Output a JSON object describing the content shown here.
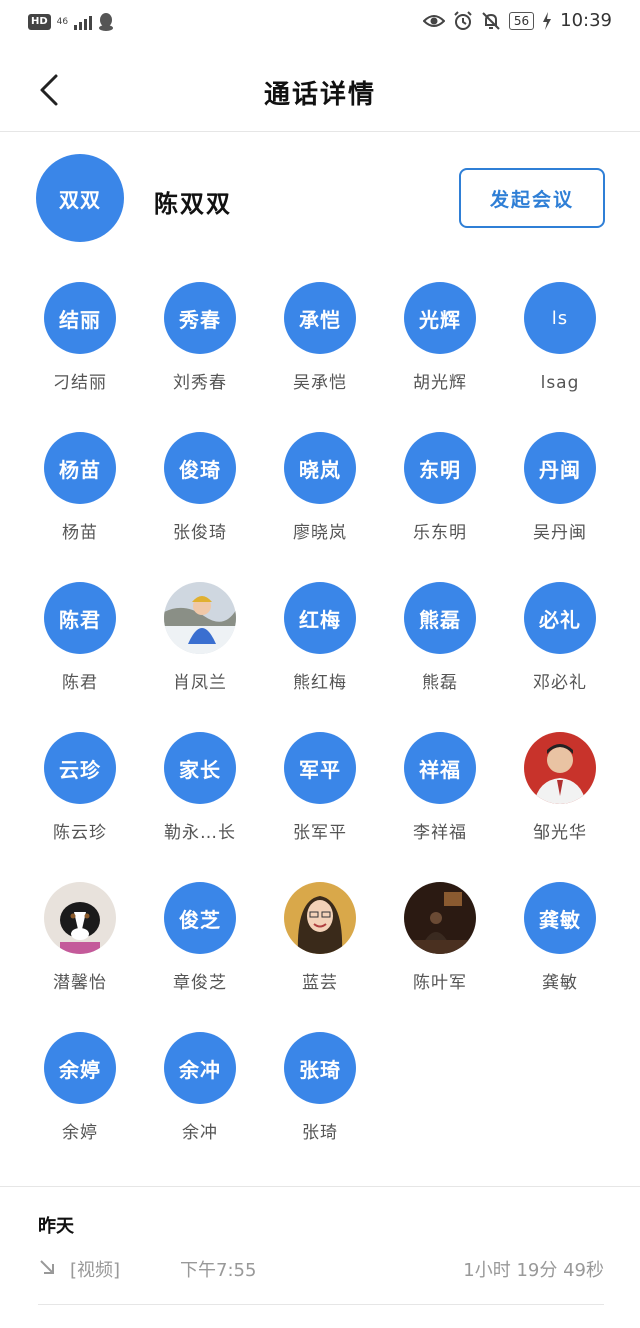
{
  "status_bar": {
    "hd": "HD",
    "network": "46",
    "battery": "56",
    "time": "10:39"
  },
  "header": {
    "title": "通话详情"
  },
  "owner": {
    "avatar_text": "双双",
    "name": "陈双双",
    "meeting_button": "发起会议"
  },
  "contacts": [
    {
      "avatar_text": "结丽",
      "name": "刁结丽"
    },
    {
      "avatar_text": "秀春",
      "name": "刘秀春"
    },
    {
      "avatar_text": "承恺",
      "name": "吴承恺"
    },
    {
      "avatar_text": "光辉",
      "name": "胡光辉"
    },
    {
      "avatar_text": "ls",
      "name": "lsag"
    },
    {
      "avatar_text": "杨苗",
      "name": "杨苗"
    },
    {
      "avatar_text": "俊琦",
      "name": "张俊琦"
    },
    {
      "avatar_text": "晓岚",
      "name": "廖晓岚"
    },
    {
      "avatar_text": "东明",
      "name": "乐东明"
    },
    {
      "avatar_text": "丹闽",
      "name": "吴丹闽"
    },
    {
      "avatar_text": "陈君",
      "name": "陈君"
    },
    {
      "avatar_text": "",
      "name": "肖凤兰",
      "photo": "child-in-snow"
    },
    {
      "avatar_text": "红梅",
      "name": "熊红梅"
    },
    {
      "avatar_text": "熊磊",
      "name": "熊磊"
    },
    {
      "avatar_text": "必礼",
      "name": "邓必礼"
    },
    {
      "avatar_text": "云珍",
      "name": "陈云珍"
    },
    {
      "avatar_text": "家长",
      "name": "勒永…长"
    },
    {
      "avatar_text": "军平",
      "name": "张军平"
    },
    {
      "avatar_text": "祥福",
      "name": "李祥福"
    },
    {
      "avatar_text": "",
      "name": "邹光华",
      "photo": "man-portrait"
    },
    {
      "avatar_text": "",
      "name": "潜馨怡",
      "photo": "dog"
    },
    {
      "avatar_text": "俊芝",
      "name": "章俊芝"
    },
    {
      "avatar_text": "",
      "name": "蓝芸",
      "photo": "woman-smiling"
    },
    {
      "avatar_text": "",
      "name": "陈叶军",
      "photo": "dark-room"
    },
    {
      "avatar_text": "龚敏",
      "name": "龚敏"
    },
    {
      "avatar_text": "余婷",
      "name": "余婷"
    },
    {
      "avatar_text": "余冲",
      "name": "余冲"
    },
    {
      "avatar_text": "张琦",
      "name": "张琦"
    }
  ],
  "history": {
    "date_label": "昨天",
    "call": {
      "type": "[视频]",
      "time": "下午7:55",
      "duration": "1小时 19分 49秒"
    }
  },
  "colors": {
    "accent": "#3a86e8",
    "button_border": "#2f7fd6"
  },
  "icons": {
    "back": "chevron-left-icon",
    "call_direction": "incoming-arrow-icon"
  }
}
